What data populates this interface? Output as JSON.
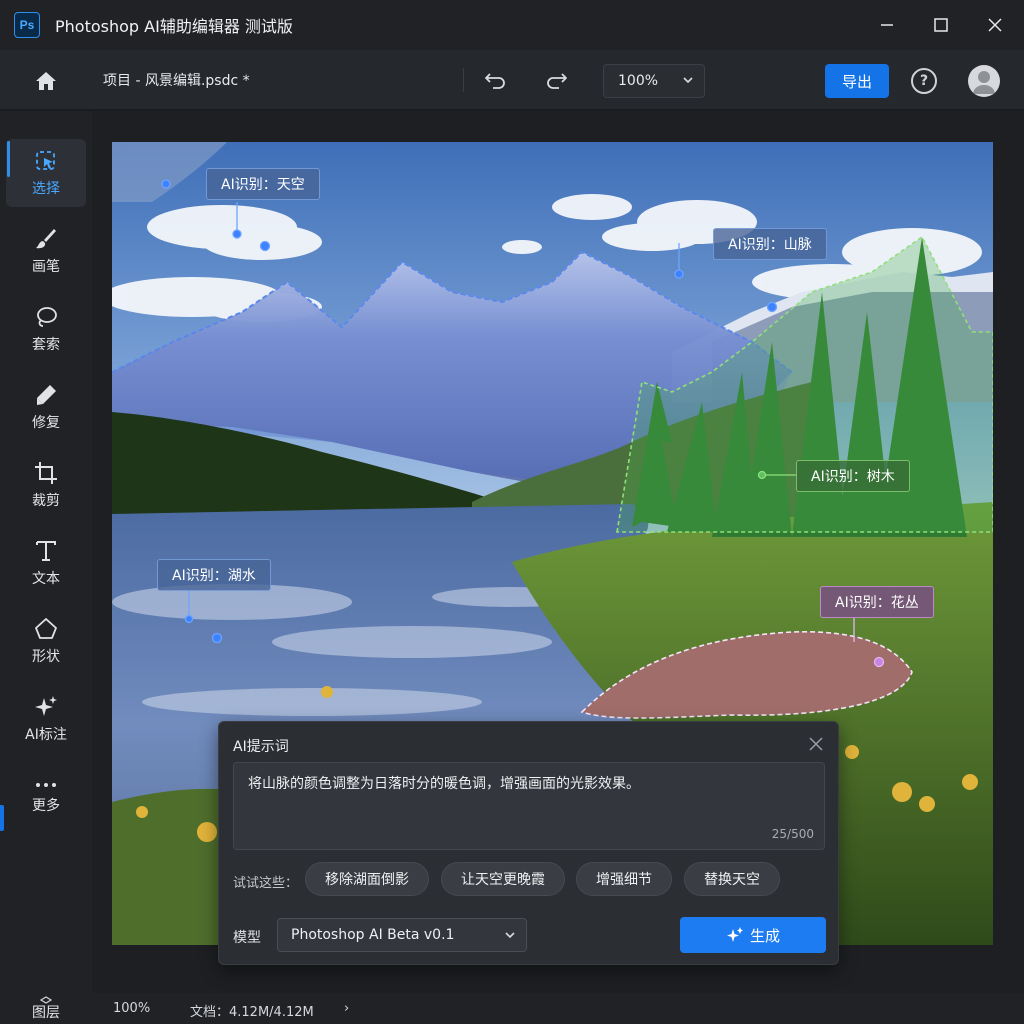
{
  "window": {
    "logo_text": "Ps",
    "title": "Photoshop AI辅助编辑器 测试版"
  },
  "toolbar": {
    "document_name": "项目 - 风景编辑.psdc *",
    "zoom_value": "100%",
    "export_label": "导出",
    "help_label": "?"
  },
  "sidebar": {
    "tools": [
      {
        "label": "选择",
        "icon": "select-icon",
        "active": true
      },
      {
        "label": "画笔",
        "icon": "brush-icon"
      },
      {
        "label": "套索",
        "icon": "lasso-icon"
      },
      {
        "label": "修复",
        "icon": "heal-icon"
      },
      {
        "label": "裁剪",
        "icon": "crop-icon"
      },
      {
        "label": "文本",
        "icon": "text-icon"
      },
      {
        "label": "形状",
        "icon": "shape-icon"
      },
      {
        "label": "AI标注",
        "icon": "ai-sparkle-icon"
      },
      {
        "label": "更多",
        "icon": "more-icon"
      }
    ],
    "layers_label": "图层"
  },
  "ai_labels": {
    "sky": "AI识别：天空",
    "mountain": "AI识别：山脉",
    "trees": "AI识别：树木",
    "lake": "AI识别：湖水",
    "flowers": "AI识别：花丛"
  },
  "prompt_panel": {
    "title": "AI提示词",
    "text": "将山脉的颜色调整为日落时分的暖色调，增强画面的光影效果。",
    "char_count": "25/500",
    "suggestions_label": "试试这些：",
    "suggestions": [
      "移除湖面倒影",
      "让天空更晚霞",
      "增强细节",
      "替换天空"
    ],
    "model_label": "模型",
    "model_value": "Photoshop AI Beta v0.1",
    "generate_label": "生成"
  },
  "statusbar": {
    "zoom": "100%",
    "doc_info": "文档：4.12M/4.12M",
    "arrow": "›"
  },
  "colors": {
    "accent": "#1473e6",
    "sky_overlay": "#4a78c8",
    "tree_overlay": "#4caf50",
    "flower_overlay": "#9b59b6"
  }
}
